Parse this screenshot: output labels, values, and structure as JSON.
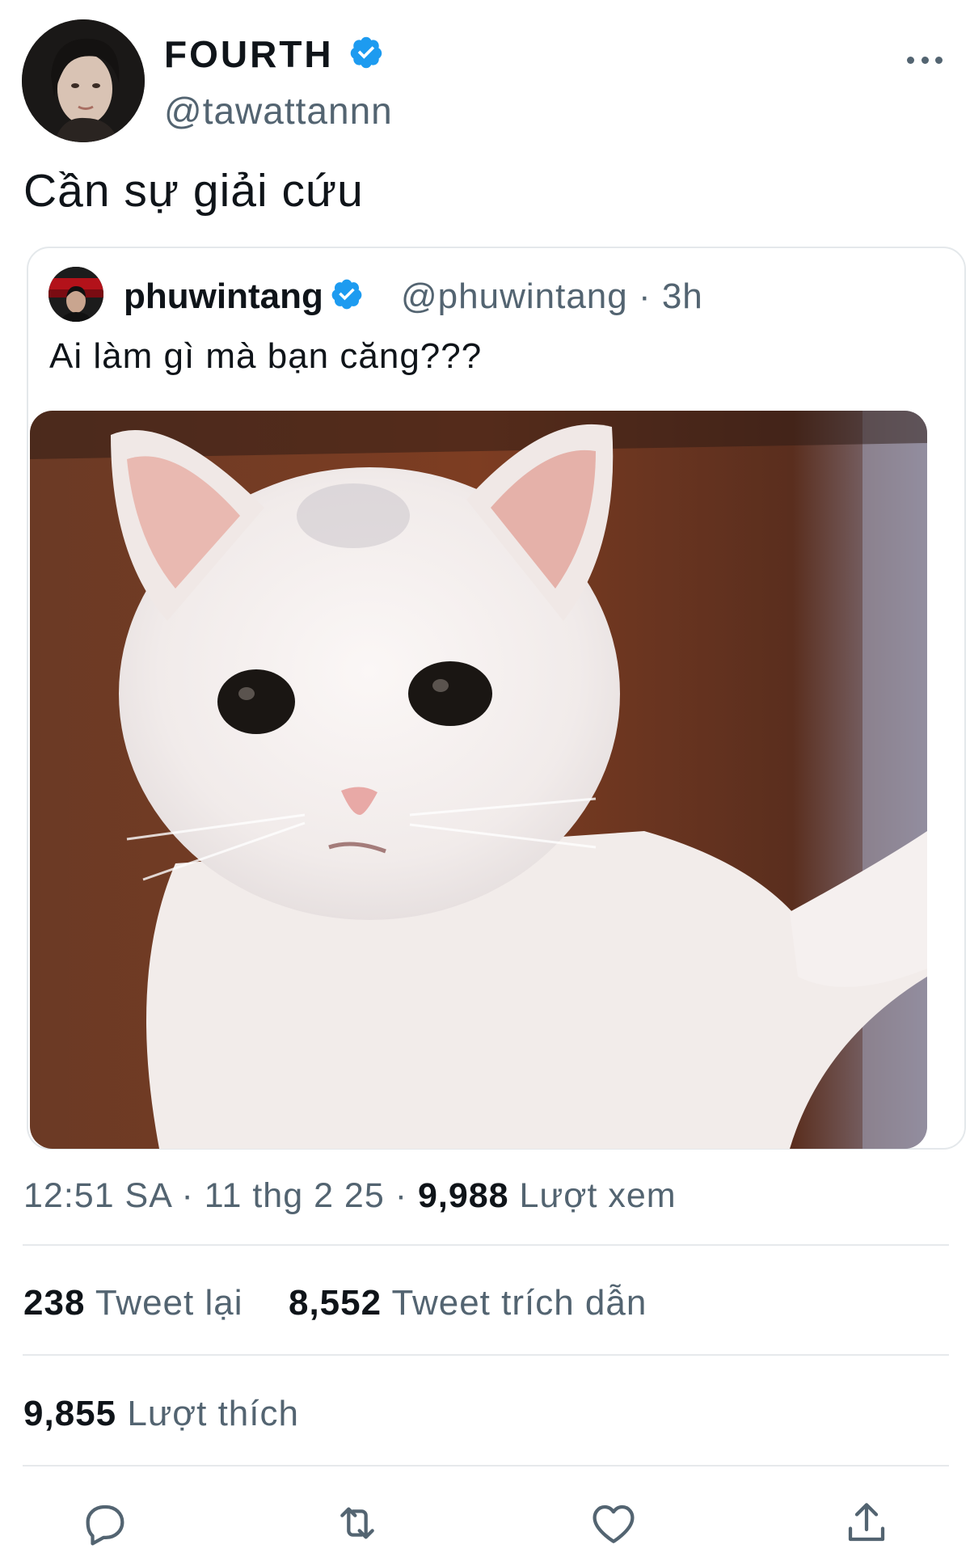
{
  "author": {
    "display_name": "FOURTH",
    "handle": "@tawattannn",
    "verified": true,
    "avatar_icon": "profile-photo"
  },
  "more_icon": "more-horizontal-icon",
  "tweet": {
    "text": "Cần sự giải cứu"
  },
  "quoted_tweet": {
    "display_name": "phuwintang",
    "meta": "@phuwintang · 3h",
    "text": "Ai làm gì mà bạn căng???",
    "image_icon": "white-cat-photo"
  },
  "meta": {
    "time": "12:51 SA",
    "sep": " · ",
    "date": "11 thg 2 25",
    "views_count": "9,988",
    "views_label": "Lượt xem"
  },
  "stats": {
    "retweets_count": "238",
    "retweets_label": "Tweet lại",
    "quotes_count": "8,552",
    "quotes_label": "Tweet trích dẫn",
    "likes_count": "9,855",
    "likes_label": "Lượt thích"
  },
  "actions": [
    "reply-icon",
    "retweet-icon",
    "like-icon",
    "share-icon"
  ],
  "colors": {
    "verified": "#1d9bf0",
    "text_primary": "#0f1419",
    "text_secondary": "#536471",
    "divider": "#e6e9ec"
  }
}
